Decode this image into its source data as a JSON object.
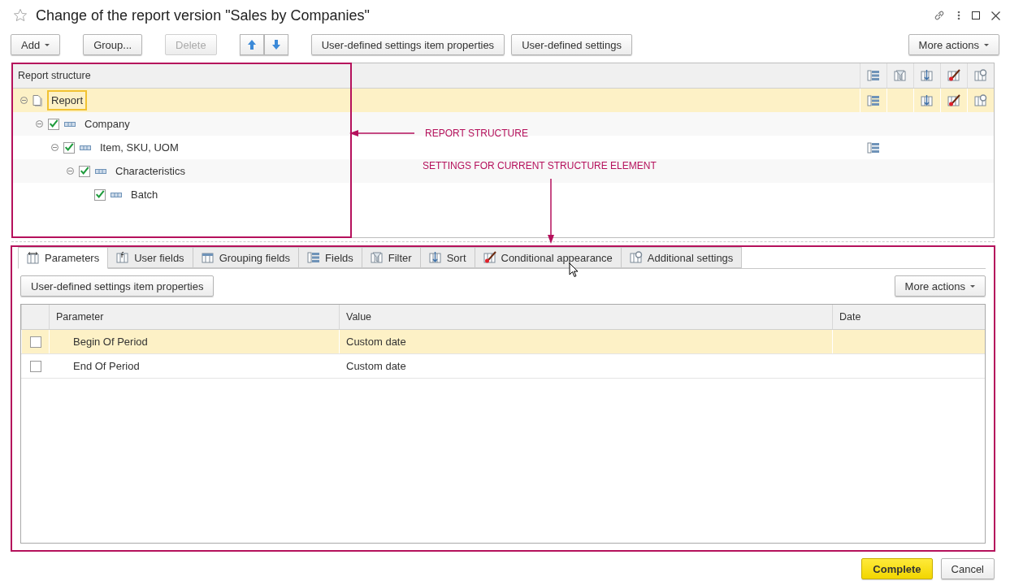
{
  "window": {
    "title": "Change of the report version \"Sales by Companies\""
  },
  "toolbar": {
    "buttons": [
      {
        "label": "Add",
        "kind": "menu",
        "disabled": false
      },
      {
        "label": "Group...",
        "kind": "plain",
        "disabled": false
      },
      {
        "label": "Delete",
        "kind": "plain",
        "disabled": true
      },
      {
        "kind": "up",
        "disabled": false
      },
      {
        "kind": "down",
        "disabled": false
      },
      {
        "label": "User-defined settings item properties",
        "kind": "plain",
        "disabled": false
      },
      {
        "label": "User-defined settings",
        "kind": "plain",
        "disabled": false
      }
    ],
    "more": "More actions"
  },
  "structure": {
    "header": "Report structure",
    "items": [
      {
        "label": "Report",
        "kind": "report",
        "expanded": true,
        "selected": true,
        "settings": [
          true,
          false,
          true,
          true,
          true
        ],
        "children": [
          {
            "label": "Company",
            "kind": "grouping",
            "checked": true,
            "expanded": true,
            "selected": false,
            "settings": [
              false,
              false,
              false,
              false,
              false
            ],
            "children": [
              {
                "label": "Item, SKU, UOM",
                "kind": "grouping",
                "checked": true,
                "expanded": true,
                "selected": false,
                "settings": [
                  true,
                  false,
                  false,
                  false,
                  false
                ],
                "children": [
                  {
                    "label": "Characteristics",
                    "kind": "grouping",
                    "checked": true,
                    "expanded": true,
                    "selected": false,
                    "settings": [
                      false,
                      false,
                      false,
                      false,
                      false
                    ],
                    "children": [
                      {
                        "label": "Batch",
                        "kind": "grouping",
                        "checked": true,
                        "selected": false,
                        "settings": [
                          false,
                          false,
                          false,
                          false,
                          false
                        ]
                      }
                    ]
                  }
                ]
              }
            ]
          }
        ]
      }
    ]
  },
  "annotations": [
    "REPORT STRUCTURE",
    "SETTINGS FOR CURRENT STRUCTURE ELEMENT"
  ],
  "tabs": [
    {
      "label": "Parameters",
      "kind": "parameters",
      "selected": true
    },
    {
      "label": "User fields",
      "kind": "userfields",
      "selected": false
    },
    {
      "label": "Grouping fields",
      "kind": "grouping",
      "selected": false
    },
    {
      "label": "Fields",
      "kind": "fields",
      "selected": false
    },
    {
      "label": "Filter",
      "kind": "filter",
      "selected": false
    },
    {
      "label": "Sort",
      "kind": "sort",
      "selected": false
    },
    {
      "label": "Conditional appearance",
      "kind": "appearance",
      "selected": false
    },
    {
      "label": "Additional settings",
      "kind": "additional",
      "selected": false
    }
  ],
  "parameters": {
    "button": "User-defined settings item properties",
    "more": "More actions",
    "columns": [
      "Parameter",
      "Value",
      "Date"
    ],
    "rows": [
      {
        "checked": false,
        "selected": true,
        "parameter": "Begin Of Period",
        "value": "Custom date"
      },
      {
        "checked": false,
        "selected": false,
        "parameter": "End Of Period",
        "value": "Custom date"
      }
    ]
  },
  "footer": [
    {
      "label": "Complete",
      "kind": "default"
    },
    {
      "label": "Cancel",
      "kind": "plain"
    }
  ]
}
